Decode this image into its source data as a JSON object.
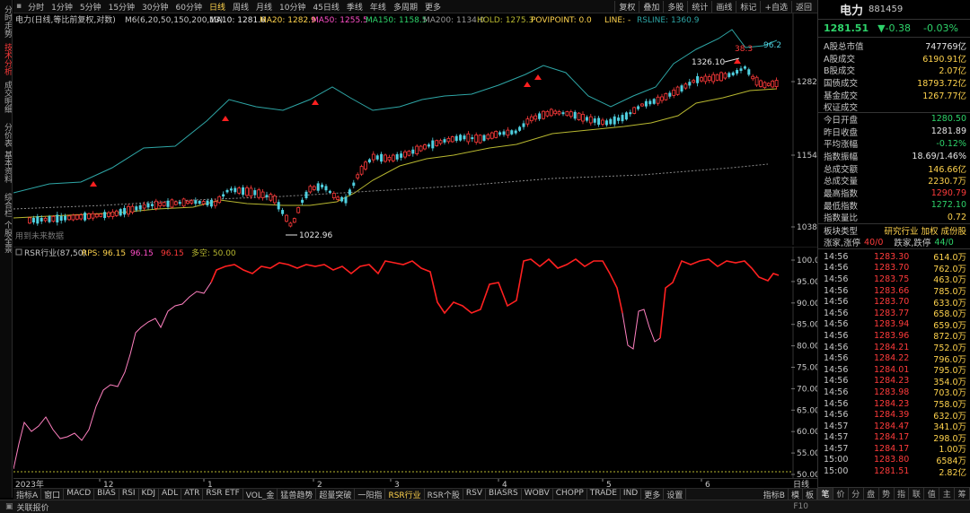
{
  "left_tabs": [
    "分时走势",
    "技术分析",
    "成交明细",
    "分价表",
    "基本资料",
    "综合栏",
    "个股全景"
  ],
  "toolbar": {
    "periods": [
      "分时",
      "1分钟",
      "5分钟",
      "15分钟",
      "30分钟",
      "60分钟",
      "日线",
      "周线",
      "月线",
      "10分钟",
      "45日线",
      "季线",
      "年线",
      "多周期",
      "更多"
    ],
    "active": "日线",
    "right": [
      "复权",
      "叠加",
      "多股",
      "统计",
      "画线",
      "标记",
      "+自选",
      "返回"
    ]
  },
  "main": {
    "title": "电力(日线,等比前复权,对数)",
    "indicators": [
      {
        "t": "M6(6,20,50,150,200,13)",
        "c": "#c8c8c8"
      },
      {
        "t": "MA10: 1281.6",
        "c": "#e6e6e6"
      },
      {
        "t": "MA20: 1282.9",
        "c": "#ffd34d"
      },
      {
        "t": "MA50: 1255.5",
        "c": "#ff4fc8"
      },
      {
        "t": "MA150: 1158.5",
        "c": "#2ed36a"
      },
      {
        "t": "MA200: 1134.0",
        "c": "#9a9a9a"
      },
      {
        "t": "HOLD: 1275.3",
        "c": "#b8b830"
      },
      {
        "t": "POVIPOINT: 0.0",
        "c": "#ffd34d"
      },
      {
        "t": "LINE: -",
        "c": "#ffd34d"
      },
      {
        "t": "RSLINE: 1360.9",
        "c": "#2ea6a6"
      }
    ],
    "annotations": {
      "high": "1326.10",
      "low": "1022.96",
      "peak_label": "38.3",
      "end_label": "96.2",
      "watermark": "用到未来数据"
    },
    "y_ticks": [
      "1282",
      "1154",
      "1038"
    ]
  },
  "rsr": {
    "title": "RSR行业(87,50)",
    "items": [
      {
        "t": "RPS: 96.15",
        "c": "#ffd34d"
      },
      {
        "t": "96.15",
        "c": "#ff4fc8"
      },
      {
        "t": "96.15",
        "c": "#ff3b3b"
      },
      {
        "t": "多空: 50.00",
        "c": "#b8b830"
      }
    ],
    "y_ticks": [
      "100.0",
      "95.00",
      "90.00",
      "85.00",
      "80.00",
      "75.00",
      "70.00",
      "65.00",
      "60.00",
      "55.00",
      "50.00"
    ]
  },
  "dates": {
    "year": "2023年",
    "months": [
      "12",
      "1",
      "2",
      "3",
      "4",
      "5",
      "6"
    ],
    "right": "日线"
  },
  "bottom_tabs": [
    "指标A",
    "窗口",
    "MACD",
    "BIAS",
    "RSI",
    "KDJ",
    "ADL",
    "ATR",
    "RSR ETF",
    "VOL_金",
    "猛兽趋势",
    "超量突破",
    "一阳指",
    "RSR行业",
    "RSR个股",
    "RSV",
    "BIASRS",
    "WOBV",
    "CHOPP",
    "TRADE",
    "IND",
    "更多",
    "设置"
  ],
  "bottom_active": "RSR行业",
  "bottom_right": [
    "指标B",
    "模",
    "板"
  ],
  "status": {
    "left": "关联报价",
    "right": "F10"
  },
  "panel": {
    "name": "电力",
    "code": "881459",
    "price": "1281.51",
    "change": "▼-0.38",
    "pct": "-0.03%",
    "stats": [
      {
        "k": "A股总市值",
        "v": "747769亿",
        "c": "white"
      },
      {
        "k": "A股成交",
        "v": "6190.91亿",
        "c": "yellow"
      },
      {
        "k": "B股成交",
        "v": "2.07亿",
        "c": "yellow"
      },
      {
        "k": "国债成交",
        "v": "18793.72亿",
        "c": "yellow"
      },
      {
        "k": "基金成交",
        "v": "1267.77亿",
        "c": "yellow"
      },
      {
        "k": "权证成交",
        "v": "",
        "c": "yellow"
      },
      {
        "k": "今日开盘",
        "v": "1280.50",
        "c": "green"
      },
      {
        "k": "昨日收盘",
        "v": "1281.89",
        "c": "white"
      },
      {
        "k": "平均涨幅",
        "v": "-0.12%",
        "c": "green"
      },
      {
        "k": "指数振幅",
        "v": "18.69/1.46%",
        "c": "white"
      },
      {
        "k": "总成交额",
        "v": "146.66亿",
        "c": "yellow"
      },
      {
        "k": "总成交量",
        "v": "2230.7万",
        "c": "yellow"
      },
      {
        "k": "最高指数",
        "v": "1290.79",
        "c": "red"
      },
      {
        "k": "最低指数",
        "v": "1272.10",
        "c": "green"
      },
      {
        "k": "指数量比",
        "v": "0.72",
        "c": "yellow"
      }
    ],
    "board_type": {
      "k": "板块类型",
      "v": "研究行业 加权 成份股"
    },
    "rise_fall": {
      "up_label": "涨家,涨停",
      "up_v": "40/0",
      "down_label": "跌家,跌停",
      "down_v": "44/0"
    },
    "ticks": [
      {
        "t": "14:56",
        "p": "1283.30",
        "v": "614.0万"
      },
      {
        "t": "14:56",
        "p": "1283.70",
        "v": "762.0万"
      },
      {
        "t": "14:56",
        "p": "1283.75",
        "v": "463.0万"
      },
      {
        "t": "14:56",
        "p": "1283.66",
        "v": "785.0万"
      },
      {
        "t": "14:56",
        "p": "1283.70",
        "v": "633.0万"
      },
      {
        "t": "14:56",
        "p": "1283.77",
        "v": "658.0万"
      },
      {
        "t": "14:56",
        "p": "1283.94",
        "v": "659.0万"
      },
      {
        "t": "14:56",
        "p": "1283.96",
        "v": "872.0万"
      },
      {
        "t": "14:56",
        "p": "1284.21",
        "v": "752.0万"
      },
      {
        "t": "14:56",
        "p": "1284.22",
        "v": "796.0万"
      },
      {
        "t": "14:56",
        "p": "1284.01",
        "v": "795.0万"
      },
      {
        "t": "14:56",
        "p": "1284.23",
        "v": "354.0万"
      },
      {
        "t": "14:56",
        "p": "1283.98",
        "v": "703.0万"
      },
      {
        "t": "14:56",
        "p": "1284.23",
        "v": "758.0万"
      },
      {
        "t": "14:56",
        "p": "1284.39",
        "v": "632.0万"
      },
      {
        "t": "14:57",
        "p": "1284.47",
        "v": "341.0万"
      },
      {
        "t": "14:57",
        "p": "1284.17",
        "v": "298.0万"
      },
      {
        "t": "14:57",
        "p": "1284.17",
        "v": "1.00万"
      },
      {
        "t": "15:00",
        "p": "1283.80",
        "v": "6584万"
      },
      {
        "t": "15:00",
        "p": "1281.51",
        "v": "2.82亿"
      }
    ],
    "tabs": [
      "笔",
      "价",
      "分",
      "盘",
      "势",
      "指",
      "联",
      "值",
      "主",
      "筹"
    ],
    "tab_active": "笔"
  },
  "colors": {
    "up": "#ff3b3b",
    "down": "#4fd0e0",
    "accent": "#ffd34d"
  }
}
